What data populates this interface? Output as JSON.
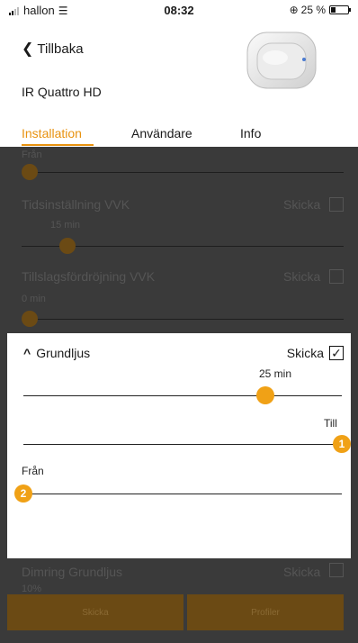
{
  "status": {
    "carrier": "hallon",
    "time": "08:32",
    "battery": "25 %",
    "battery_level": 0.25
  },
  "header": {
    "back_label": "Tillbaka",
    "title": "IR Quattro HD",
    "tabs": [
      {
        "label": "Installation",
        "active": true
      },
      {
        "label": "Användare",
        "active": false
      },
      {
        "label": "Info",
        "active": false
      }
    ]
  },
  "background": {
    "top_label": "Från",
    "tidsinstallning": {
      "label": "Tidsinställning VVK",
      "send": "Skicka",
      "value": "15 min"
    },
    "tillslag": {
      "label": "Tillslagsfördröjning VVK",
      "send": "Skicka",
      "value": "0 min"
    },
    "dimring": {
      "label": "Dimring Grundljus",
      "send": "Skicka",
      "value": "10%"
    },
    "buttons": {
      "send": "Skicka",
      "profiles": "Profiler"
    }
  },
  "panel": {
    "title": "Grundljus",
    "send_label": "Skicka",
    "checked": true,
    "slider_time": {
      "value_label": "25 min",
      "level": 0.76
    },
    "slider_till": {
      "value_label": "Till",
      "marker": "1",
      "level": 1.0
    },
    "slider_fran": {
      "value_label": "Från",
      "marker": "2",
      "level": 0.0
    }
  },
  "colors": {
    "accent": "#f0a116",
    "tab_active": "#e8920f",
    "dim_bg": "#3a3a3a"
  }
}
